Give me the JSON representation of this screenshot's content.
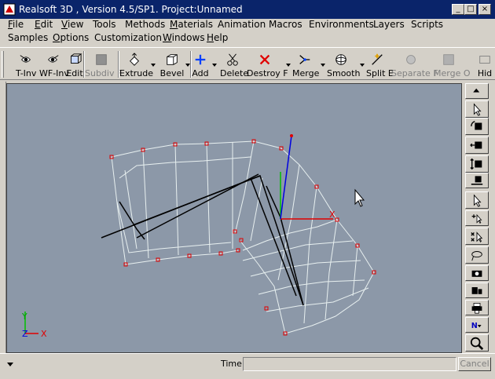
{
  "window": {
    "title": "Realsoft 3D , Version 4.5/SP1. Project:Unnamed",
    "min_glyph": "_",
    "max_glyph": "□",
    "close_glyph": "×"
  },
  "menu": {
    "row1": [
      {
        "label": "File",
        "mnemonic": "F",
        "rest": "ile"
      },
      {
        "label": "Edit",
        "mnemonic": "E",
        "rest": "dit"
      },
      {
        "label": "View",
        "mnemonic": "V",
        "rest": "iew"
      },
      {
        "label": "Tools",
        "mnemonic": "",
        "rest": "Tools"
      },
      {
        "label": "Methods",
        "mnemonic": "",
        "rest": "Methods"
      },
      {
        "label": "Materials",
        "mnemonic": "M",
        "rest": "aterials"
      },
      {
        "label": "Animation",
        "mnemonic": "",
        "rest": "Animation"
      },
      {
        "label": "Macros",
        "mnemonic": "",
        "rest": "Macros"
      },
      {
        "label": "Environments",
        "mnemonic": "",
        "rest": "Environments"
      },
      {
        "label": "Layers",
        "mnemonic": "",
        "rest": "Layers"
      },
      {
        "label": "Scripts",
        "mnemonic": "",
        "rest": "Scripts"
      }
    ],
    "row2": [
      {
        "label": "Samples",
        "mnemonic": "",
        "rest": "Samples"
      },
      {
        "label": "Options",
        "mnemonic": "O",
        "rest": "ptions"
      },
      {
        "label": "Customization",
        "mnemonic": "",
        "rest": "Customization"
      },
      {
        "label": "Windows",
        "mnemonic": "W",
        "rest": "indows"
      },
      {
        "label": "Help",
        "mnemonic": "H",
        "rest": "elp"
      }
    ]
  },
  "toolbar": {
    "items": [
      {
        "label": "T-Inv",
        "icon": "eye-arrow-icon",
        "enabled": true
      },
      {
        "label": "WF-Inv",
        "icon": "eye-arrow-left-icon",
        "enabled": true
      },
      {
        "label": "Edit",
        "icon": "edit-cube-icon",
        "enabled": true
      },
      {
        "label": "Subdiv F",
        "icon": "gray-square-icon",
        "enabled": false
      },
      {
        "label": "Extrude",
        "icon": "extrude-icon",
        "enabled": true
      },
      {
        "label": "Bevel",
        "icon": "bevel-icon",
        "enabled": true
      },
      {
        "label": "Add",
        "icon": "add-cross-icon",
        "enabled": true
      },
      {
        "label": "Delete",
        "icon": "scissors-icon",
        "enabled": true
      },
      {
        "label": "Destroy F",
        "icon": "destroy-icon",
        "enabled": true
      },
      {
        "label": "Merge",
        "icon": "merge-icon",
        "enabled": true
      },
      {
        "label": "Smooth",
        "icon": "smooth-sphere-icon",
        "enabled": true
      },
      {
        "label": "Split E",
        "icon": "split-icon",
        "enabled": true
      },
      {
        "label": "Separate F",
        "icon": "separate-icon",
        "enabled": false
      },
      {
        "label": "Merge O",
        "icon": "merge-objects-icon",
        "enabled": false
      },
      {
        "label": "Hid",
        "icon": "hide-icon",
        "enabled": true
      }
    ]
  },
  "viewport": {
    "axis_x": "X",
    "axis_y": "Y",
    "axis_z": "Z",
    "gizmo_x": "X",
    "background": "#8c98a8"
  },
  "right_tools": [
    "scroll-up-icon",
    "select-arrow-icon",
    "rotate-view-icon",
    "pan-view-icon",
    "zoom-view-icon",
    "camera-dolly-icon",
    "select-pointer-icon",
    "add-select-icon",
    "subtract-select-icon",
    "lasso-icon",
    "camera-icon",
    "render-icon",
    "printer-icon",
    "nav-icon",
    "magnifier-icon",
    "scroll-down-icon"
  ],
  "status": {
    "time_label": "Time:",
    "time_value": "",
    "cancel_label": "Cancel"
  }
}
